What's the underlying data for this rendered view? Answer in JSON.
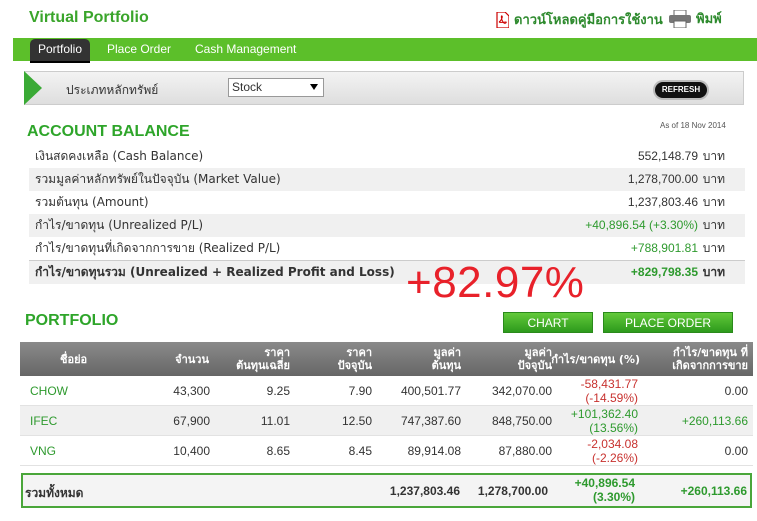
{
  "header": {
    "title": "Virtual Portfolio",
    "manual_link": "ดาวน์โหลดคู่มือการใช้งาน",
    "print_link": "พิมพ์"
  },
  "nav": {
    "tabs": [
      {
        "label": "Portfolio",
        "active": true
      },
      {
        "label": "Place Order",
        "active": false
      },
      {
        "label": "Cash Management",
        "active": false
      }
    ]
  },
  "filter": {
    "label": "ประเภทหลักทรัพย์",
    "selected": "Stock",
    "refresh_label": "REFRESH"
  },
  "account": {
    "title": "ACCOUNT BALANCE",
    "as_of": "As of 18 Nov 2014",
    "rows": [
      {
        "label": "เงินสดคงเหลือ (Cash Balance)",
        "value": "552,148.79",
        "unit": "บาท"
      },
      {
        "label": "รวมมูลค่าหลักทรัพย์ในปัจจุบัน (Market Value)",
        "value": "1,278,700.00",
        "unit": "บาท"
      },
      {
        "label": "รวมต้นทุน (Amount)",
        "value": "1,237,803.46",
        "unit": "บาท"
      },
      {
        "label": "กำไร/ขาดทุน (Unrealized P/L)",
        "value": "+40,896.54 (+3.30%)",
        "unit": "บาท"
      },
      {
        "label": "กำไร/ขาดทุนที่เกิดจากการขาย (Realized P/L)",
        "value": "+788,901.81",
        "unit": "บาท"
      },
      {
        "label": "กำไร/ขาดทุนรวม (Unrealized + Realized Profit and Loss)",
        "value": "+829,798.35",
        "unit": "บาท"
      }
    ],
    "big_percent": "+82.97%"
  },
  "portfolio": {
    "title": "PORTFOLIO",
    "chart_button": "CHART",
    "order_button": "PLACE ORDER",
    "columns": {
      "symbol": "ชื่อย่อ",
      "volume": "จำนวน",
      "avg_cost_1": "ราคา",
      "avg_cost_2": "ต้นทุนเฉลี่ย",
      "price_1": "ราคา",
      "price_2": "ปัจจุบัน",
      "cost_value_1": "มูลค่า",
      "cost_value_2": "ต้นทุน",
      "market_value_1": "มูลค่า",
      "market_value_2": "ปัจจุบัน",
      "unrealized": "กำไร/ขาดทุน (%)",
      "realized_1": "กำไร/ขาดทุน ที่",
      "realized_2": "เกิดจากการขาย"
    },
    "rows": [
      {
        "symbol": "CHOW",
        "volume": "43,300",
        "avg_cost": "9.25",
        "price": "7.90",
        "cost_value": "400,501.77",
        "market_value": "342,070.00",
        "pl": "-58,431.77",
        "pl_pct": "(-14.59%)",
        "realized": "0.00"
      },
      {
        "symbol": "IFEC",
        "volume": "67,900",
        "avg_cost": "11.01",
        "price": "12.50",
        "cost_value": "747,387.60",
        "market_value": "848,750.00",
        "pl": "+101,362.40",
        "pl_pct": "(13.56%)",
        "realized": "+260,113.66"
      },
      {
        "symbol": "VNG",
        "volume": "10,400",
        "avg_cost": "8.65",
        "price": "8.45",
        "cost_value": "89,914.08",
        "market_value": "87,880.00",
        "pl": "-2,034.08",
        "pl_pct": "(-2.26%)",
        "realized": "0.00"
      }
    ],
    "total": {
      "label": "รวมทั้งหมด",
      "cost_value": "1,237,803.46",
      "market_value": "1,278,700.00",
      "pl": "+40,896.54",
      "pl_pct": "(3.30%)",
      "realized": "+260,113.66"
    }
  },
  "colors": {
    "brand_green": "#5cbf2a",
    "title_green": "#2ea52a",
    "loss_red": "#c8322f",
    "highlight_red": "#e8212a"
  }
}
